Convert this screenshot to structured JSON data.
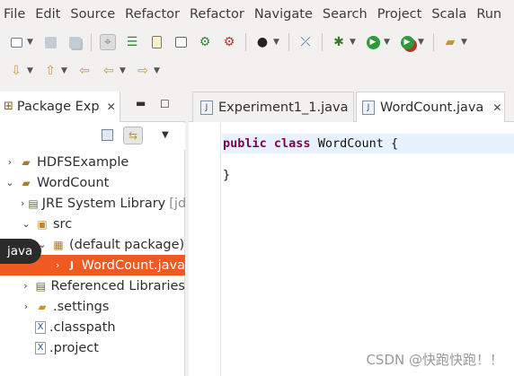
{
  "menubar": {
    "items": [
      "File",
      "Edit",
      "Source",
      "Refactor",
      "Refactor",
      "Navigate",
      "Search",
      "Project",
      "Scala",
      "Run"
    ]
  },
  "toolbar": {
    "row1_icons": [
      "new-icon",
      "save-icon",
      "save-all-icon",
      "toggle-selection-icon",
      "task-list-icon",
      "open-file-icon",
      "console-icon",
      "new-java-project-icon",
      "new-package-icon",
      "profile-icon",
      "breakpoint-icon",
      "debug-icon",
      "run-icon",
      "run-last-icon",
      "open-folder-icon"
    ],
    "row2_icons": [
      "next-annotation-icon",
      "previous-annotation-icon",
      "last-edit-icon",
      "back-icon",
      "forward-icon"
    ]
  },
  "package_explorer": {
    "tab_label": "Package Exp",
    "tree": [
      {
        "label": "HDFSExample",
        "icon": "project-folder-icon",
        "twisty": "collapsed",
        "level": 0
      },
      {
        "label": "WordCount",
        "icon": "project-folder-icon",
        "twisty": "expanded",
        "level": 0
      },
      {
        "label": "JRE System Library",
        "suffix": "[jd",
        "icon": "library-icon",
        "twisty": "collapsed",
        "level": 1
      },
      {
        "label": "src",
        "icon": "source-folder-icon",
        "twisty": "expanded",
        "level": 1
      },
      {
        "label": "(default package)",
        "icon": "package-icon",
        "twisty": "expanded",
        "level": 2
      },
      {
        "label": "WordCount.java",
        "icon": "java-file-icon",
        "twisty": "collapsed",
        "level": 3,
        "selected": true
      },
      {
        "label": "Referenced Libraries",
        "icon": "library-icon",
        "twisty": "collapsed",
        "level": 1
      },
      {
        "label": ".settings",
        "icon": "folder-icon",
        "twisty": "collapsed",
        "level": 1
      },
      {
        "label": ".classpath",
        "icon": "xml-file-icon",
        "twisty": "none",
        "level": 1
      },
      {
        "label": ".project",
        "icon": "xml-file-icon",
        "twisty": "none",
        "level": 1
      }
    ]
  },
  "tooltip": {
    "text": "java"
  },
  "editor": {
    "tabs": [
      {
        "label": "Experiment1_1.java",
        "active": false
      },
      {
        "label": "WordCount.java",
        "active": true
      }
    ],
    "code": {
      "kw1": "public",
      "kw2": "class",
      "class_name": "WordCount",
      "open_brace": "{",
      "close_brace": "}"
    }
  },
  "watermark": "CSDN @快跑快跑！！",
  "colors": {
    "selection": "#f05a22",
    "keyword": "#7f0055",
    "current_line": "#e8f2fe"
  }
}
